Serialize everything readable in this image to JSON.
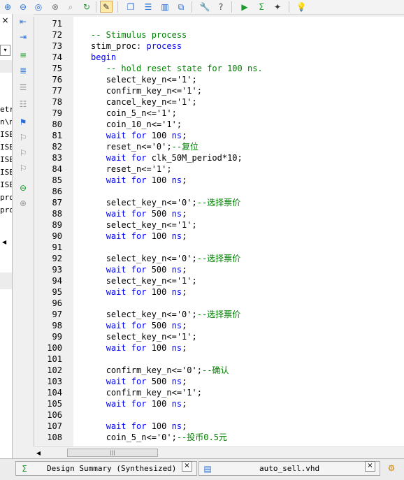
{
  "toolbar": {
    "icons": [
      "zoom-in-icon",
      "zoom-out-icon",
      "zoom-fit-icon",
      "zoom-full-icon",
      "zoom-select-icon",
      "refresh-icon",
      "edit-icon",
      "cascade-windows-icon",
      "tile-horizontal-icon",
      "tile-vertical-icon",
      "restore-windows-icon",
      "tools-icon",
      "help-icon",
      "run-icon",
      "sum-icon",
      "probe-icon",
      "tip-icon"
    ]
  },
  "left_panel": {
    "close_glyph": "×",
    "list_items": [
      "etr",
      "n\\n",
      "ISE",
      "ISE",
      "ISE",
      "ISE",
      "ISE",
      "pro",
      "pro"
    ]
  },
  "editor": {
    "lines": [
      {
        "n": "71",
        "indent": "",
        "parts": []
      },
      {
        "n": "72",
        "indent": "",
        "parts": [
          {
            "t": "-- Stimulus process",
            "c": "cm"
          }
        ]
      },
      {
        "n": "73",
        "indent": "",
        "parts": [
          {
            "t": "stim_proc: ",
            "c": "tx"
          },
          {
            "t": "process",
            "c": "kw"
          }
        ]
      },
      {
        "n": "74",
        "indent": "",
        "parts": [
          {
            "t": "begin",
            "c": "kw"
          }
        ]
      },
      {
        "n": "75",
        "indent": "   ",
        "parts": [
          {
            "t": "-- hold reset state for 100 ns.",
            "c": "cm"
          }
        ]
      },
      {
        "n": "76",
        "indent": "   ",
        "parts": [
          {
            "t": "select_key_n<='1';",
            "c": "tx"
          }
        ]
      },
      {
        "n": "77",
        "indent": "   ",
        "parts": [
          {
            "t": "confirm_key_n<='1';",
            "c": "tx"
          }
        ]
      },
      {
        "n": "78",
        "indent": "   ",
        "parts": [
          {
            "t": "cancel_key_n<='1';",
            "c": "tx"
          }
        ]
      },
      {
        "n": "79",
        "indent": "   ",
        "parts": [
          {
            "t": "coin_5_n<='1';",
            "c": "tx"
          }
        ]
      },
      {
        "n": "80",
        "indent": "   ",
        "parts": [
          {
            "t": "coin_10_n<='1';",
            "c": "tx"
          }
        ]
      },
      {
        "n": "81",
        "indent": "   ",
        "parts": [
          {
            "t": "wait for",
            "c": "kw"
          },
          {
            "t": " 100 ",
            "c": "tx"
          },
          {
            "t": "ns",
            "c": "kw"
          },
          {
            "t": ";",
            "c": "tx"
          }
        ]
      },
      {
        "n": "82",
        "indent": "   ",
        "parts": [
          {
            "t": "reset_n<='0';",
            "c": "tx"
          },
          {
            "t": "--复位",
            "c": "cm"
          }
        ]
      },
      {
        "n": "83",
        "indent": "   ",
        "parts": [
          {
            "t": "wait for",
            "c": "kw"
          },
          {
            "t": " clk_50M_period*10;",
            "c": "tx"
          }
        ]
      },
      {
        "n": "84",
        "indent": "   ",
        "parts": [
          {
            "t": "reset_n<='1';",
            "c": "tx"
          }
        ]
      },
      {
        "n": "85",
        "indent": "   ",
        "parts": [
          {
            "t": "wait for",
            "c": "kw"
          },
          {
            "t": " 100 ",
            "c": "tx"
          },
          {
            "t": "ns",
            "c": "kw"
          },
          {
            "t": ";",
            "c": "tx"
          }
        ]
      },
      {
        "n": "86",
        "indent": "",
        "parts": []
      },
      {
        "n": "87",
        "indent": "   ",
        "parts": [
          {
            "t": "select_key_n<='0';",
            "c": "tx"
          },
          {
            "t": "--选择票价",
            "c": "cm"
          }
        ]
      },
      {
        "n": "88",
        "indent": "   ",
        "parts": [
          {
            "t": "wait for",
            "c": "kw"
          },
          {
            "t": " 500 ",
            "c": "tx"
          },
          {
            "t": "ns",
            "c": "kw"
          },
          {
            "t": ";",
            "c": "tx"
          }
        ]
      },
      {
        "n": "89",
        "indent": "   ",
        "parts": [
          {
            "t": "select_key_n<='1';",
            "c": "tx"
          }
        ]
      },
      {
        "n": "90",
        "indent": "   ",
        "parts": [
          {
            "t": "wait for",
            "c": "kw"
          },
          {
            "t": " 100 ",
            "c": "tx"
          },
          {
            "t": "ns",
            "c": "kw"
          },
          {
            "t": ";",
            "c": "tx"
          }
        ]
      },
      {
        "n": "91",
        "indent": "",
        "parts": []
      },
      {
        "n": "92",
        "indent": "   ",
        "parts": [
          {
            "t": "select_key_n<='0';",
            "c": "tx"
          },
          {
            "t": "--选择票价",
            "c": "cm"
          }
        ]
      },
      {
        "n": "93",
        "indent": "   ",
        "parts": [
          {
            "t": "wait for",
            "c": "kw"
          },
          {
            "t": " 500 ",
            "c": "tx"
          },
          {
            "t": "ns",
            "c": "kw"
          },
          {
            "t": ";",
            "c": "tx"
          }
        ]
      },
      {
        "n": "94",
        "indent": "   ",
        "parts": [
          {
            "t": "select_key_n<='1';",
            "c": "tx"
          }
        ]
      },
      {
        "n": "95",
        "indent": "   ",
        "parts": [
          {
            "t": "wait for",
            "c": "kw"
          },
          {
            "t": " 100 ",
            "c": "tx"
          },
          {
            "t": "ns",
            "c": "kw"
          },
          {
            "t": ";",
            "c": "tx"
          }
        ]
      },
      {
        "n": "96",
        "indent": "",
        "parts": []
      },
      {
        "n": "97",
        "indent": "   ",
        "parts": [
          {
            "t": "select_key_n<='0';",
            "c": "tx"
          },
          {
            "t": "--选择票价",
            "c": "cm"
          }
        ]
      },
      {
        "n": "98",
        "indent": "   ",
        "parts": [
          {
            "t": "wait for",
            "c": "kw"
          },
          {
            "t": " 500 ",
            "c": "tx"
          },
          {
            "t": "ns",
            "c": "kw"
          },
          {
            "t": ";",
            "c": "tx"
          }
        ]
      },
      {
        "n": "99",
        "indent": "   ",
        "parts": [
          {
            "t": "select_key_n<='1';",
            "c": "tx"
          }
        ]
      },
      {
        "n": "100",
        "indent": "   ",
        "parts": [
          {
            "t": "wait for",
            "c": "kw"
          },
          {
            "t": " 100 ",
            "c": "tx"
          },
          {
            "t": "ns",
            "c": "kw"
          },
          {
            "t": ";",
            "c": "tx"
          }
        ]
      },
      {
        "n": "101",
        "indent": "",
        "parts": []
      },
      {
        "n": "102",
        "indent": "   ",
        "parts": [
          {
            "t": "confirm_key_n<='0';",
            "c": "tx"
          },
          {
            "t": "--确认",
            "c": "cm"
          }
        ]
      },
      {
        "n": "103",
        "indent": "   ",
        "parts": [
          {
            "t": "wait for",
            "c": "kw"
          },
          {
            "t": " 500 ",
            "c": "tx"
          },
          {
            "t": "ns",
            "c": "kw"
          },
          {
            "t": ";",
            "c": "tx"
          }
        ]
      },
      {
        "n": "104",
        "indent": "   ",
        "parts": [
          {
            "t": "confirm_key_n<='1';",
            "c": "tx"
          }
        ]
      },
      {
        "n": "105",
        "indent": "   ",
        "parts": [
          {
            "t": "wait for",
            "c": "kw"
          },
          {
            "t": " 100 ",
            "c": "tx"
          },
          {
            "t": "ns",
            "c": "kw"
          },
          {
            "t": ";",
            "c": "tx"
          }
        ]
      },
      {
        "n": "106",
        "indent": "",
        "parts": []
      },
      {
        "n": "107",
        "indent": "   ",
        "parts": [
          {
            "t": "wait for",
            "c": "kw"
          },
          {
            "t": " 100 ",
            "c": "tx"
          },
          {
            "t": "ns",
            "c": "kw"
          },
          {
            "t": ";",
            "c": "tx"
          }
        ]
      },
      {
        "n": "108",
        "indent": "   ",
        "parts": [
          {
            "t": "coin_5_n<='0';",
            "c": "tx"
          },
          {
            "t": "--投币0.5元",
            "c": "cm"
          }
        ]
      }
    ]
  },
  "tabs": [
    {
      "label": "Design Summary (Synthesized)",
      "icon": "sigma-icon",
      "glyph": "Σ"
    },
    {
      "label": "auto_sell.vhd",
      "icon": "document-icon",
      "glyph": "▤"
    }
  ],
  "tab_close_glyph": "×",
  "colors": {
    "keyword": "#0000ff",
    "comment": "#008000",
    "text": "#000000",
    "gutter": "#f0f0f0"
  }
}
